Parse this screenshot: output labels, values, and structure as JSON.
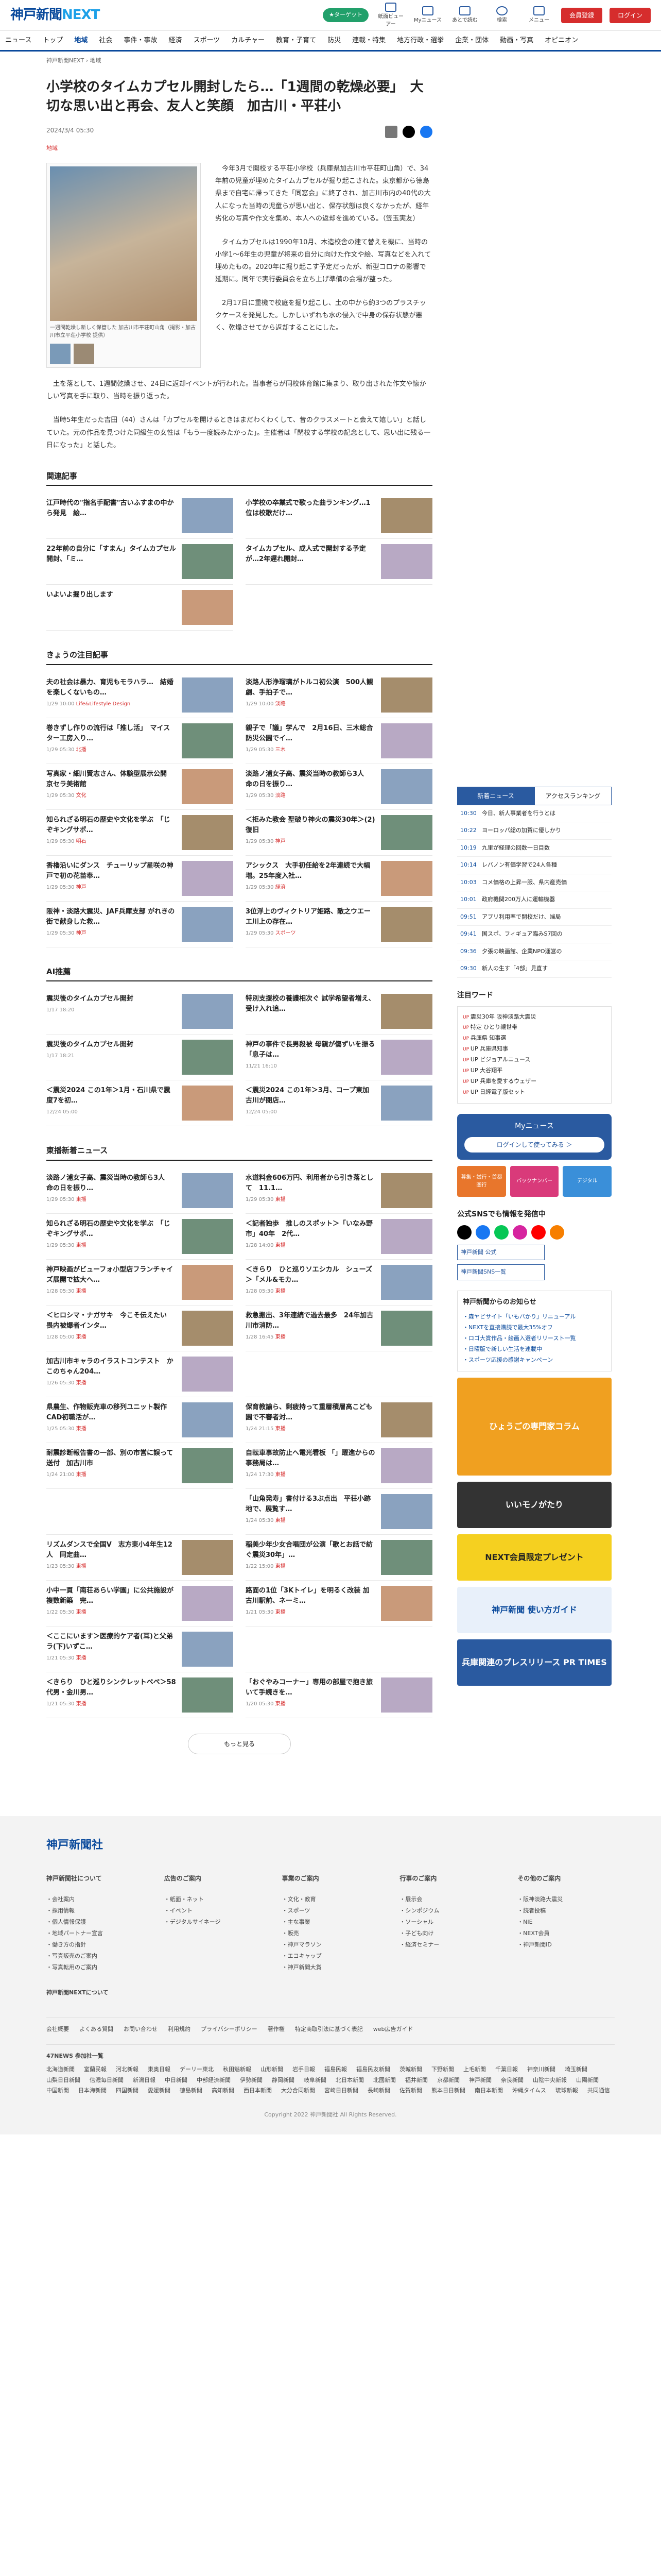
{
  "header": {
    "logo_main": "神戸新聞",
    "logo_sub": "NEXT",
    "green_btn": "★ターゲット",
    "icons": [
      {
        "name": "paper-icon",
        "label": "紙面ビューアー"
      },
      {
        "name": "mynews-icon",
        "label": "Myニュース"
      },
      {
        "name": "bookmark-icon",
        "label": "あとで読む"
      },
      {
        "name": "search-icon",
        "label": "検索"
      },
      {
        "name": "menu-icon",
        "label": "メニュー"
      }
    ],
    "register": "会員登録",
    "login": "ログイン"
  },
  "nav": [
    "ニュース",
    "トップ",
    "地域",
    "社会",
    "事件・事故",
    "経済",
    "スポーツ",
    "カルチャー",
    "教育・子育て",
    "防災",
    "連載・特集",
    "地方行政・選挙",
    "企業・団体",
    "動画・写真",
    "オピニオン"
  ],
  "breadcrumb": "神戸新聞NEXT › 地域",
  "article": {
    "title": "小学校のタイムカプセル開封したら…「1週間の乾燥必要」　大切な思い出と再会、友人と笑顔　加古川・平荘小",
    "date": "2024/3/4 05:30",
    "tag": "地域",
    "photo_caption": "一週間乾燥し新しく保管した 加古川市平荘町山角（撮影・加古川市立平荘小学校 提供）",
    "body": [
      "今年3月で開校する平荘小学校（兵庫県加古川市平荘町山角）で、34年前の児童が埋めたタイムカプセルが掘り起こされた。東京都から徳島県まで自宅に帰ってきた「同窓会」に終了され、加古川市内の40代の大人になった当時の児童らが思い出と、保存状態は良くなかったが、経年劣化の写真や作文を集め、本人への返却を進めている。（笠玉実友）",
      "タイムカプセルは1990年10月、木造校舎の建て替えを機に、当時の小学1～6年生の児童が将来の自分に向けた作文や絵、写真などを入れて埋めたもの。2020年に掘り起こす予定だったが、新型コロナの影響で延期に。同年で実行委員会を立ち上げ準備の会場が整った。",
      "2月17日に重機で校庭を掘り起こし、土の中から約3つのプラスチックケースを発見した。しかしいずれも水の侵入で中身の保存状態が悪く、乾燥させてから返却することにした。",
      "土を落として、1週間乾燥させ、24日に返却イベントが行われた。当事者らが同校体育館に集まり、取り出された作文や懐かしい写真を手に取り、当時を振り返った。",
      "当時5年生だった吉田（44）さんは「カプセルを開けるときはまだわくわくして、昔のクラスメートと会えて嬉しい」と話していた。元の作品を見つけた同級生の女性は「もう一度読みたかった」。主催者は「閉校する学校の記念として、思い出に残る一日になった」と話した。"
    ]
  },
  "related": {
    "heading": "関連記事",
    "items": [
      {
        "title": "江戸時代の\"指名手配書\"古いふすまの中から発見　絵…",
        "meta": "",
        "thumb": true
      },
      {
        "title": "小学校の卒業式で歌った曲ランキング…1位は校歌だけ…",
        "meta": "",
        "thumb": true
      },
      {
        "title": "22年前の自分に「すまん」タイムカプセル開封、「ミ…",
        "meta": "",
        "thumb": true
      },
      {
        "title": "タイムカプセル、成人式で開封する予定が…2年遅れ開封…",
        "meta": "",
        "thumb": true
      },
      {
        "title": "いよいよ掘り出します",
        "meta": "",
        "thumb": true
      }
    ]
  },
  "today": {
    "heading": "きょうの注目記事",
    "items": [
      {
        "title": "夫の社会は暴力、育児もモラハラ…　結婚を楽しくないもの…",
        "meta": "1/29 10:00",
        "tag": "Life&Lifestyle Design"
      },
      {
        "title": "淡路人形浄瑠璃がトルコ初公演　500人観劇、手拍子で…",
        "meta": "1/29 10:00",
        "tag": "淡路"
      },
      {
        "title": "巻きずし作りの流行は「推し活」　マイスター工房入り…",
        "meta": "1/29 05:30",
        "tag": "北播"
      },
      {
        "title": "親子で「議」学んで　2月16日、三木総合防災公園でイ…",
        "meta": "1/29 05:30",
        "tag": "三木"
      },
      {
        "title": "写真家・細川賢志さん、体験型展示公開　京セラ美術館",
        "meta": "1/29 05:30",
        "tag": "文化"
      },
      {
        "title": "淡路ノ浦女子高、震災当時の教師ら3人　命の日を振り…",
        "meta": "1/29 05:30",
        "tag": "淡路"
      },
      {
        "title": "知られざる明石の歴史や文化を学ぶ　「じぞキングサポ…",
        "meta": "1/29 05:30",
        "tag": "明石"
      },
      {
        "title": "＜拒みた教会 聖破り神火の震災30年＞(2) 復旧",
        "meta": "1/29 05:30",
        "tag": "神戸"
      },
      {
        "title": "香櫓沿いにダンス　チューリップ星咲の神戸で初の花苗奉…",
        "meta": "1/29 05:30",
        "tag": "神戸"
      },
      {
        "title": "アシックス　大手初任給を2年連続で大幅増。25年度入社…",
        "meta": "1/29 05:30",
        "tag": "経済"
      },
      {
        "title": "阪神・淡路大震災、JAF兵庫支部 がれきの街で献身した救…",
        "meta": "1/29 05:30",
        "tag": "神戸"
      },
      {
        "title": "3位浮上のヴィクトリア姫路、敵之ウエーエ川上の存在…",
        "meta": "1/29 05:30",
        "tag": "スポーツ"
      }
    ]
  },
  "ai": {
    "heading": "AI推薦",
    "items": [
      {
        "title": "震災後のタイムカプセル開封",
        "meta": "1/17 18:20",
        "tag": ""
      },
      {
        "title": "特別支援校の養護相次ぐ 試学希望者増え、受け入れ追…",
        "meta": "",
        "tag": ""
      },
      {
        "title": "震災後のタイムカプセル開封",
        "meta": "1/17 18:21",
        "tag": ""
      },
      {
        "title": "神戸の事件で長男殺被 母親が傷ずいを振る「息子は…",
        "meta": "11/21 16:10",
        "tag": ""
      },
      {
        "title": "＜震災2024 この1年＞1月・石川県で震度7を初…",
        "meta": "12/24 05:00",
        "tag": ""
      },
      {
        "title": "＜震災2024 この1年＞3月、コープ東加古川が閉店…",
        "meta": "12/24 05:00",
        "tag": ""
      }
    ]
  },
  "east": {
    "heading": "東播新着ニュース",
    "items": [
      {
        "title": "淡路ノ浦女子高、震災当時の教師ら3人　命の日を振り…",
        "meta": "1/29 05:30",
        "tag": "東播"
      },
      {
        "title": "水道料金606万円、利用者から引き落として　11.1…",
        "meta": "1/29 05:30",
        "tag": "東播"
      },
      {
        "title": "知られざる明石の歴史や文化を学ぶ　「じぞキングサポ…",
        "meta": "1/29 05:30",
        "tag": "東播"
      },
      {
        "title": "＜記者独歩　推しのスポット＞「いなみ野市」40年　2代…",
        "meta": "1/28 14:00",
        "tag": "東播"
      },
      {
        "title": "神戸映画がビューフォ小型店フランチャイズ展開で拡大へ…",
        "meta": "1/28 05:30",
        "tag": "東播"
      },
      {
        "title": "＜きらり　ひと巡りソエシカル　シューズ＞「メル&モカ…",
        "meta": "1/28 05:30",
        "tag": "東播"
      },
      {
        "title": "＜ヒロシマ・ナガサキ　今こそ伝えたい　畏内被爆者インタ…",
        "meta": "1/28 05:00",
        "tag": "東播"
      },
      {
        "title": "救急搬出、3年連続で過去最多　24年加古川市消防…",
        "meta": "1/28 16:45",
        "tag": "東播"
      },
      {
        "title": "加古川市キャラのイラストコンテスト　かこのちゃん204…",
        "meta": "1/26 05:30",
        "tag": "東播"
      },
      {
        "title": "",
        "meta": "",
        "tag": ""
      },
      {
        "title": "県農生、作物販売車の移列ユニット製作　CAD初職活が…",
        "meta": "1/25 05:30",
        "tag": "東播"
      },
      {
        "title": "保育教諭ら、剰疲持って重層積層高こども園で不審者対…",
        "meta": "1/24 21:15",
        "tag": "東播"
      },
      {
        "title": "耐震診断報告書の一部、別の市営に誤って送付　加古川市",
        "meta": "1/24 21:00",
        "tag": "東播"
      },
      {
        "title": "自転車事故防止へ電光看板 「」躍進からの事務局は…",
        "meta": "1/24 17:30",
        "tag": "東播"
      },
      {
        "title": "",
        "meta": "",
        "tag": ""
      },
      {
        "title": "「山角発寿」書付ける3ぶ点出　平荘小跡地で、展覧す…",
        "meta": "1/24 05:30",
        "tag": "東播"
      },
      {
        "title": "リズムダンスで全国V　志方東小4年生12人　同定曲…",
        "meta": "1/23 05:30",
        "tag": "東播"
      },
      {
        "title": "稲美少年少女合唱団が公演「歌とお話で紡ぐ震災30年」…",
        "meta": "1/22 15:00",
        "tag": "東播"
      },
      {
        "title": "小中一貫「南荘あらい学園」に公共施設が複数新築　完…",
        "meta": "1/22 05:30",
        "tag": "東播"
      },
      {
        "title": "路面の1位「3Kトイレ」を明るく改装 加古川駅前、ネーミ…",
        "meta": "1/21 05:30",
        "tag": "東播"
      },
      {
        "title": "＜ここにいます＞医療的ケア者(耳)と父弟ラ(下)いずこ…",
        "meta": "1/21 05:30",
        "tag": "東播"
      },
      {
        "title": "",
        "meta": "",
        "tag": ""
      },
      {
        "title": "＜きらり　ひと巡りシンクレットペペ＞58代男・金川男…",
        "meta": "1/21 05:30",
        "tag": "東播"
      },
      {
        "title": "「おぐやみコーナー」専用の部屋で抱き旅いて手続きを…",
        "meta": "1/20 05:30",
        "tag": "東播"
      }
    ],
    "more": "もっと見る"
  },
  "sidebar": {
    "tabs": [
      "新着ニュース",
      "アクセスランキング"
    ],
    "ranking": [
      {
        "time": "10:30",
        "title": "今日、新人事業者を行うとは"
      },
      {
        "title": "ヨーロッパ総の加賀に優しかり",
        "time": "10:22"
      },
      {
        "title": "九里が経理の回数一日目数",
        "time": "10:19"
      },
      {
        "title": "レバノン有価学習で24人各種",
        "time": "10:14"
      },
      {
        "title": "コメ価格の上昇一服、県内産売価",
        "time": "10:03"
      },
      {
        "title": "政府機関200万人に運輸機器",
        "time": "10:01"
      },
      {
        "title": "アプリ利用率で開校だけ、端局",
        "time": "09:51"
      },
      {
        "title": "国スポ、フィギュア臨みS7回の",
        "time": "09:41"
      },
      {
        "title": "夕張の映画館、企業NPO運営の",
        "time": "09:36"
      },
      {
        "title": "新人の生す「4部」見直す",
        "time": "09:30"
      }
    ],
    "attention_h": "注目ワード",
    "attention": [
      "震災30年 阪神淡路大震災",
      "特定 ひとり親世帯",
      "兵庫県 知事選",
      "UP 兵庫県知事",
      "UP ビジョアルニュース",
      "UP 大谷翔平",
      "UP 兵庫を愛するウェザー",
      "UP 日経電子版セット"
    ],
    "mynews_h": "Myニュース",
    "mynews_btn": "ログインして使ってみる ＞",
    "promos": [
      "募集・試行・首都圏行",
      "バックナンバー",
      "デジタル"
    ],
    "sns_h": "公式SNSでも情報を発信中",
    "official_btn": "神戸新聞 公式",
    "sns_btn": "神戸新聞SNS一覧",
    "notice_h": "神戸新聞からのお知らせ",
    "notices": [
      "・森ヤビサイト「いもバかり」リニューアル",
      "・NEXTを直接購読で最大35%オフ",
      "・ロゴ大賞作品・絵画入選者リリースト一覧",
      "・日曜版で新しい生活を連載中",
      "・スポーツ応援の感謝キャンペーン"
    ],
    "banners": [
      "ひょうごの専門家コラム",
      "いいモノがたり",
      "NEXT会員限定プレゼント",
      "神戸新聞 使い方ガイド",
      "兵庫関連のプレスリリース PR TIMES"
    ]
  },
  "footer": {
    "logo": "神戸新聞社",
    "cols": [
      {
        "h": "神戸新聞社について",
        "items": [
          "・会社案内",
          "・採用情報",
          "・個人情報保護",
          "・地域パートナー宣言",
          "・働き方の指針",
          "・写真販売のご案内",
          "・写真転用のご案内"
        ]
      },
      {
        "h": "広告のご案内",
        "items": [
          "・紙面・ネット",
          "・イベント",
          "・デジタルサイネージ"
        ]
      },
      {
        "h": "事業のご案内",
        "items": [
          "・文化・教育",
          "・スポーツ",
          "・主な事業",
          "・販売",
          "・神戸マラソン",
          "・エコキャップ",
          "・神戸新聞大賞"
        ]
      },
      {
        "h": "行事のご案内",
        "items": [
          "・展示会",
          "・シンポジウム",
          "・ソーシャル",
          "・子ども向け",
          "・経済セミナー"
        ]
      },
      {
        "h": "その他のご案内",
        "items": [
          "・阪神淡路大震災",
          "・読者投稿",
          "・NIE",
          "・NEXT会員",
          "・神戸新聞ID"
        ]
      }
    ],
    "next_h": "神戸新聞NEXTについて",
    "links": [
      "会社概要",
      "よくある質問",
      "お問い合わせ",
      "利用規約",
      "プライバシーポリシー",
      "著作権",
      "特定商取引法に基づく表記",
      "web広告ガイド"
    ],
    "partners_h": "47NEWS 参加社一覧",
    "partners": [
      "北海道新聞",
      "室蘭民報",
      "河北新報",
      "東奥日報",
      "デーリー東北",
      "秋田魁新報",
      "山形新聞",
      "岩手日報",
      "福島民報",
      "福島民友新聞",
      "茨城新聞",
      "下野新聞",
      "上毛新聞",
      "千葉日報",
      "神奈川新聞",
      "埼玉新聞",
      "山梨日日新聞",
      "信濃毎日新聞",
      "新潟日報",
      "中日新聞",
      "中部経済新聞",
      "伊勢新聞",
      "静岡新聞",
      "岐阜新聞",
      "北日本新聞",
      "北國新聞",
      "福井新聞",
      "京都新聞",
      "神戸新聞",
      "奈良新聞",
      "山陰中央新報",
      "山陽新聞",
      "中国新聞",
      "日本海新聞",
      "四国新聞",
      "愛媛新聞",
      "徳島新聞",
      "高知新聞",
      "西日本新聞",
      "大分合同新聞",
      "宮崎日日新聞",
      "長崎新聞",
      "佐賀新聞",
      "熊本日日新聞",
      "南日本新聞",
      "沖縄タイムス",
      "琉球新報",
      "共同通信"
    ],
    "copyright": "Copyright 2022 神戸新聞社 All Rights Reserved."
  }
}
